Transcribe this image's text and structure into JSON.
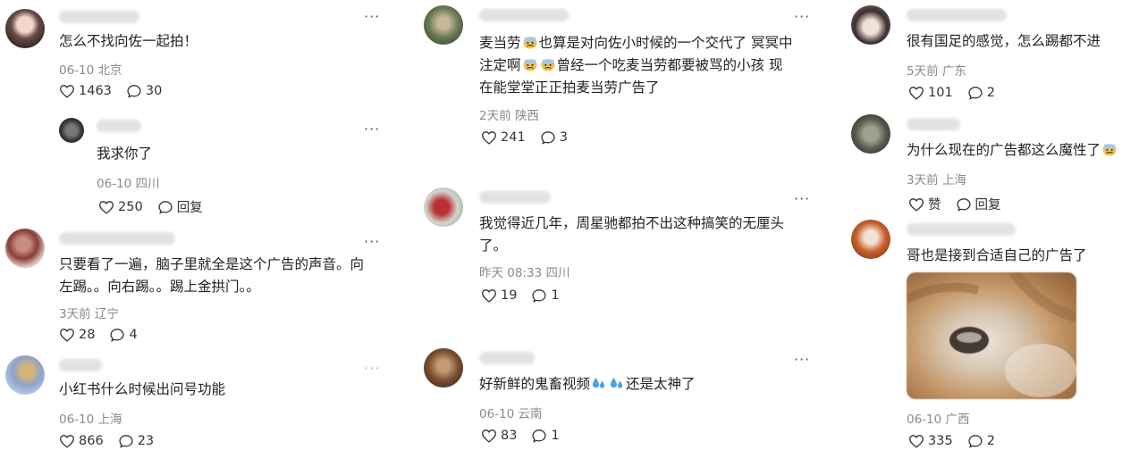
{
  "col1": [
    {
      "text": "怎么不找向佐一起拍！",
      "location": "06-10  北京",
      "likes": "1463",
      "replies": "30"
    },
    {
      "text": "我求你了",
      "location": "06-10  四川",
      "likes": "250",
      "replies": "回复"
    },
    {
      "text": "只要看了一遍，脑子里就全是这个广告的声音。向\n左踢。。向右踢。。踢上金拱门。。",
      "location": "3天前  辽宁",
      "likes": "28",
      "replies": "4"
    },
    {
      "text": "小红书什么时候出问号功能",
      "location": "06-10  上海",
      "likes": "866",
      "replies": "23"
    }
  ],
  "col2": [
    {
      "text1": "麦当劳",
      "text2": "也算是对向佐小时候的一个交代了 冥冥中",
      "text3": "注定啊",
      "text4": "曾经一个吃麦当劳都要被骂的小孩 现",
      "text5": "在能堂堂正正拍麦当劳广告了",
      "location": "2天前  陕西",
      "likes": "241",
      "replies": "3"
    },
    {
      "text": "我觉得近几年，周星驰都拍不出这种搞笑的无厘头\n了。",
      "location": "昨天 08:33  四川",
      "likes": "19",
      "replies": "1"
    },
    {
      "text1": "好新鲜的鬼畜视频",
      "text2": "还是太神了",
      "location": "06-10  云南",
      "likes": "83",
      "replies": "1"
    }
  ],
  "col3": [
    {
      "text": "很有国足的感觉，怎么踢都不进",
      "location": "5天前  广东",
      "likes": "101",
      "replies": "2"
    },
    {
      "text": "为什么现在的广告都这么魔性了",
      "location": "3天前  上海",
      "likes": "赞",
      "replies": "回复"
    },
    {
      "text": "哥也是接到合适自己的广告了",
      "location": "06-10  广西",
      "likes": "335",
      "replies": "2"
    }
  ],
  "icons": {
    "like": "heart-outline-icon",
    "reply": "speech-bubble-icon",
    "more": "more-dots-icon",
    "emoji_sweat": "sweating-face-emoji",
    "emoji_drops": "sweat-droplets-emoji"
  },
  "more_label": "···"
}
